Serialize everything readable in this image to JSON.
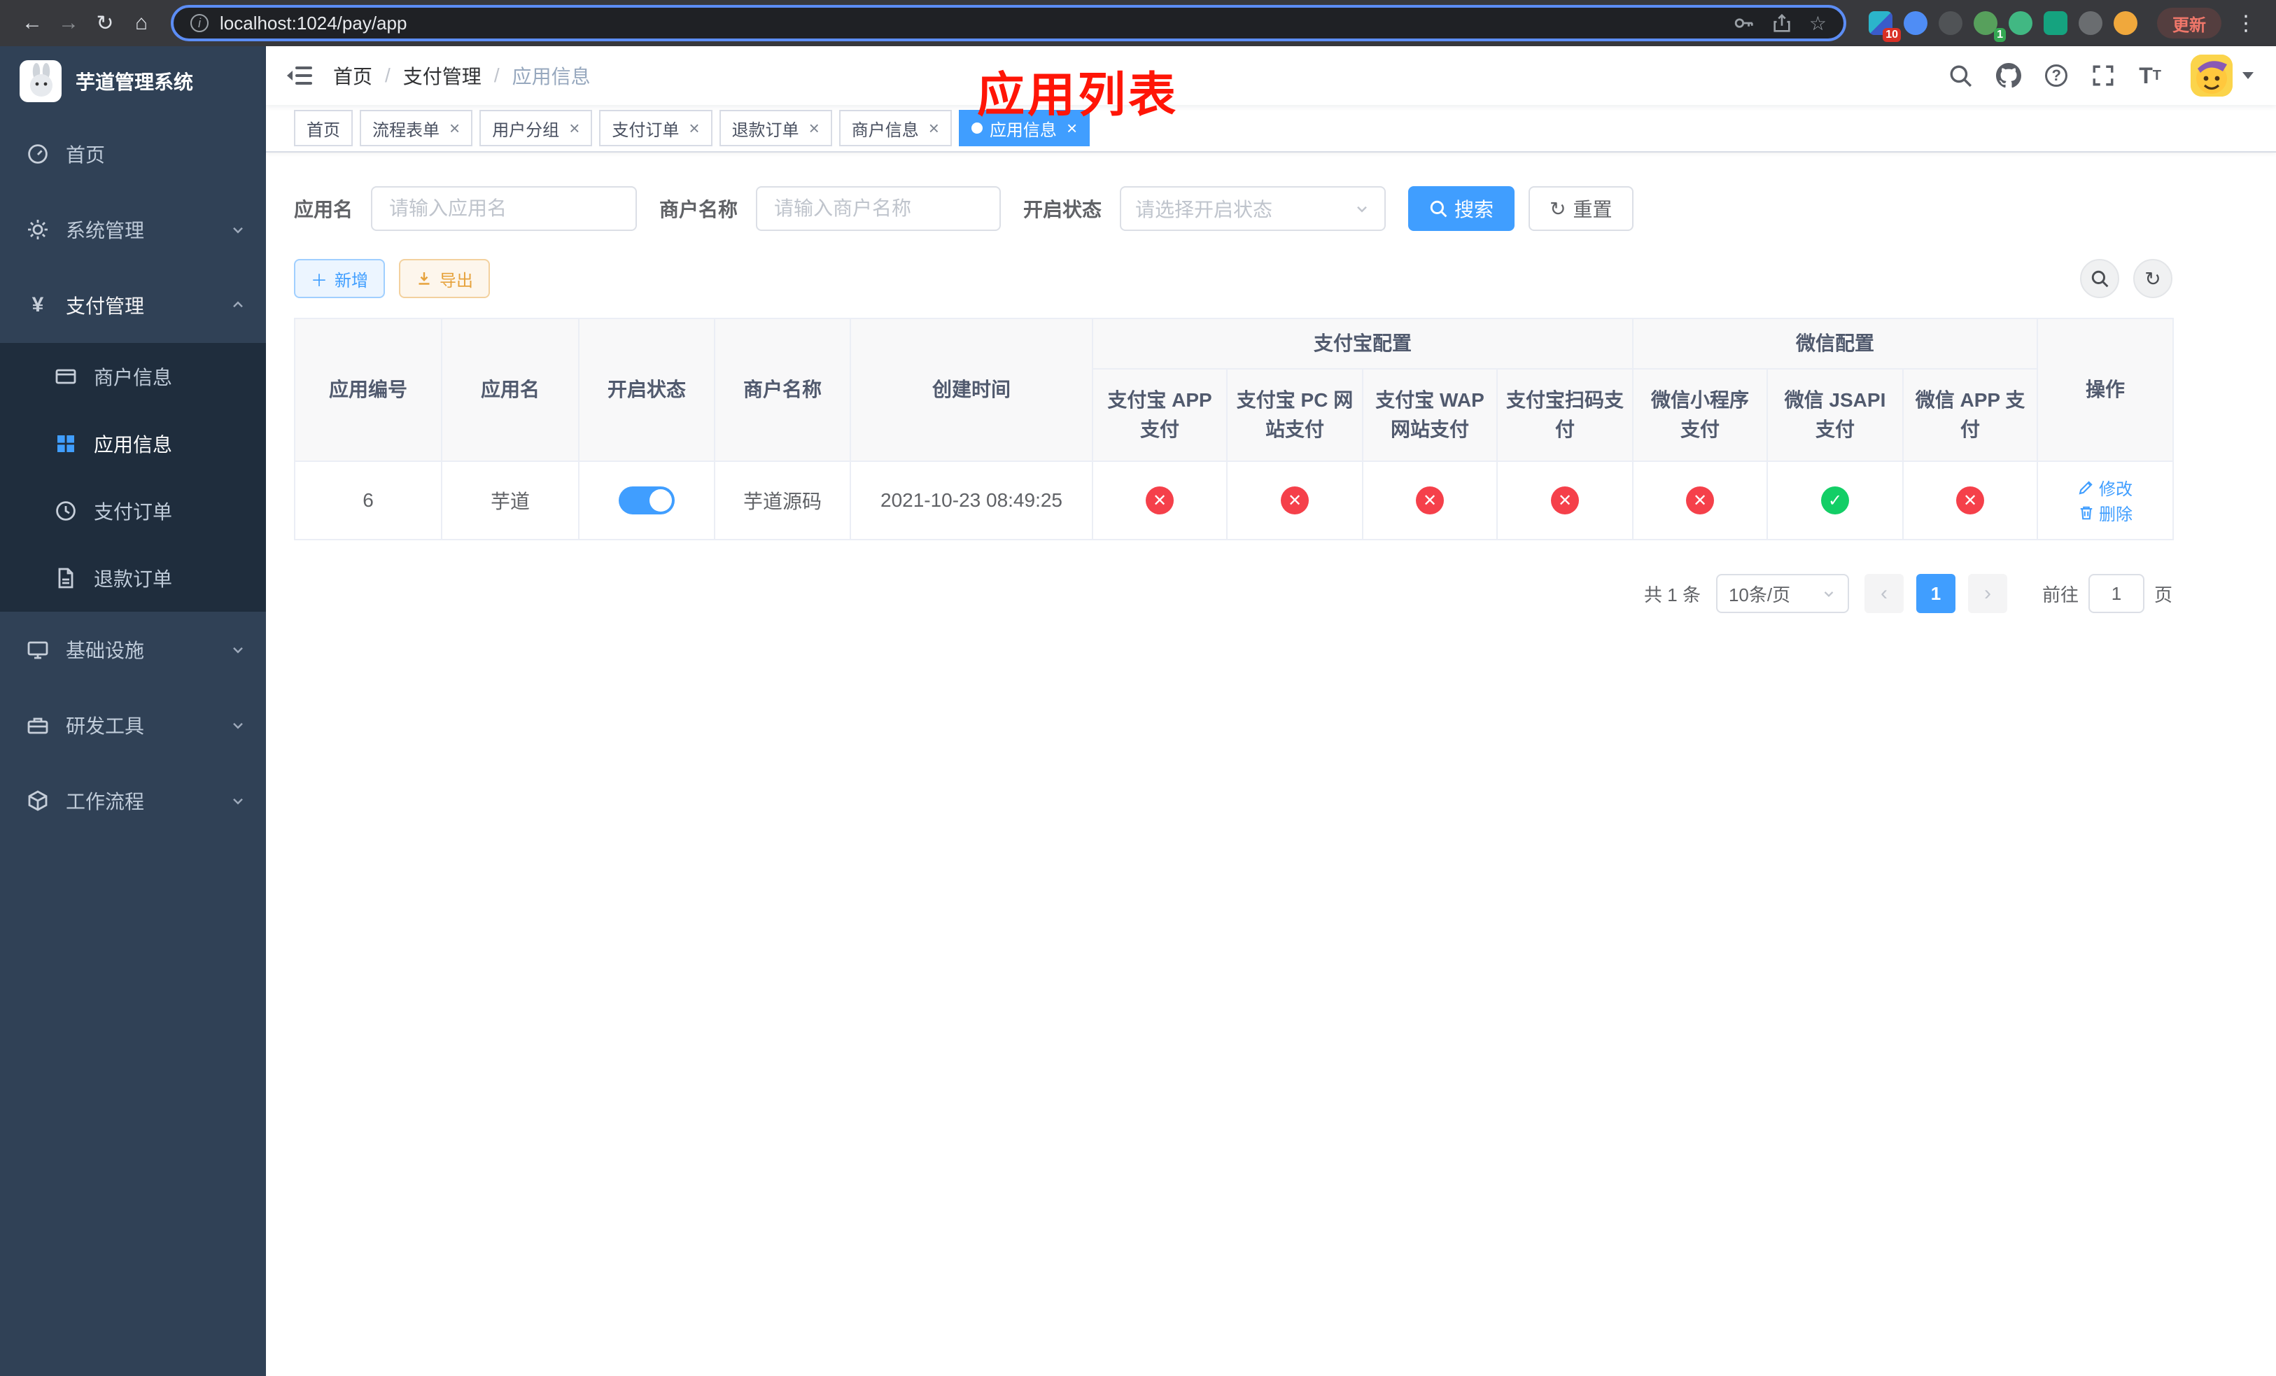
{
  "browser": {
    "url": "localhost:1024/pay/app",
    "update_label": "更新",
    "ext_badge_red": "10",
    "ext_badge_green": "1"
  },
  "sidebar": {
    "title": "芋道管理系统",
    "menu": [
      {
        "label": "首页"
      },
      {
        "label": "系统管理"
      },
      {
        "label": "支付管理"
      },
      {
        "label": "基础设施"
      },
      {
        "label": "研发工具"
      },
      {
        "label": "工作流程"
      }
    ],
    "submenu": [
      {
        "label": "商户信息"
      },
      {
        "label": "应用信息"
      },
      {
        "label": "支付订单"
      },
      {
        "label": "退款订单"
      }
    ]
  },
  "header": {
    "breadcrumb": [
      "首页",
      "支付管理",
      "应用信息"
    ],
    "separator": "/",
    "annotation": "应用列表"
  },
  "tabs": [
    {
      "label": "首页"
    },
    {
      "label": "流程表单"
    },
    {
      "label": "用户分组"
    },
    {
      "label": "支付订单"
    },
    {
      "label": "退款订单"
    },
    {
      "label": "商户信息"
    },
    {
      "label": "应用信息"
    }
  ],
  "filters": {
    "app_name_label": "应用名",
    "app_name_placeholder": "请输入应用名",
    "merchant_label": "商户名称",
    "merchant_placeholder": "请输入商户名称",
    "status_label": "开启状态",
    "status_placeholder": "请选择开启状态",
    "search_label": "搜索",
    "reset_label": "重置"
  },
  "toolbar": {
    "add_label": "新增",
    "export_label": "导出"
  },
  "table": {
    "headers": {
      "app_id": "应用编号",
      "app_name": "应用名",
      "status": "开启状态",
      "merchant": "商户名称",
      "created": "创建时间",
      "alipay_group": "支付宝配置",
      "wechat_group": "微信配置",
      "alipay_app": "支付宝 APP 支付",
      "alipay_pc": "支付宝 PC 网站支付",
      "alipay_wap": "支付宝 WAP 网站支付",
      "alipay_qr": "支付宝扫码支付",
      "wx_lite": "微信小程序支付",
      "wx_jsapi": "微信 JSAPI 支付",
      "wx_app": "微信 APP 支付",
      "actions": "操作"
    },
    "rows": [
      {
        "id": "6",
        "name": "芋道",
        "enabled": true,
        "merchant": "芋道源码",
        "created": "2021-10-23 08:49:25",
        "alipay_app": false,
        "alipay_pc": false,
        "alipay_wap": false,
        "alipay_qr": false,
        "wx_lite": false,
        "wx_jsapi": true,
        "wx_app": false,
        "edit_label": "修改",
        "delete_label": "删除"
      }
    ]
  },
  "pagination": {
    "total": "共 1 条",
    "page_size": "10条/页",
    "page": "1",
    "goto_label": "前往",
    "goto_value": "1",
    "page_unit": "页"
  },
  "colors": {
    "primary": "#409eff",
    "danger": "#f5404a",
    "success": "#13ce66",
    "sidebar_bg": "#304156",
    "annotation_red": "#ff1507"
  }
}
